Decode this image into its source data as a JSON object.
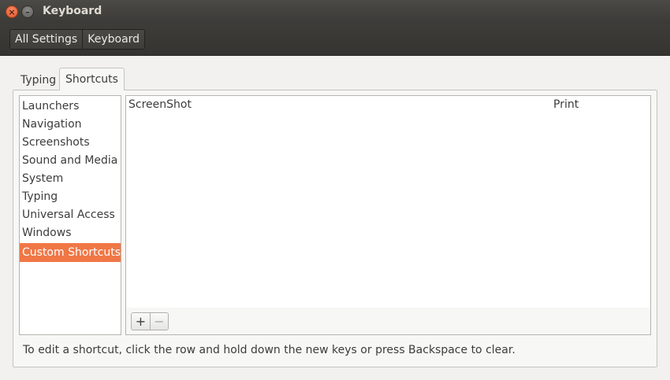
{
  "window": {
    "title": "Keyboard",
    "close_glyph": "×",
    "minimize_glyph": "–"
  },
  "breadcrumbs": [
    "All Settings",
    "Keyboard"
  ],
  "tabs": [
    {
      "label": "Typing",
      "active": false
    },
    {
      "label": "Shortcuts",
      "active": true
    }
  ],
  "categories": [
    {
      "label": "Launchers"
    },
    {
      "label": "Navigation"
    },
    {
      "label": "Screenshots"
    },
    {
      "label": "Sound and Media"
    },
    {
      "label": "System"
    },
    {
      "label": "Typing"
    },
    {
      "label": "Universal Access"
    },
    {
      "label": "Windows"
    },
    {
      "label": "Custom Shortcuts",
      "selected": true
    }
  ],
  "shortcuts": [
    {
      "name": "ScreenShot",
      "accel": "Print"
    }
  ],
  "table_toolbar": {
    "add_label": "+",
    "remove_label": "−"
  },
  "hint": "To edit a shortcut, click the row and hold down the new keys or press Backspace to clear.",
  "colors": {
    "accent": "#f07746",
    "titlebar": "#3f3e3a",
    "window_bg": "#f2f1f0"
  }
}
